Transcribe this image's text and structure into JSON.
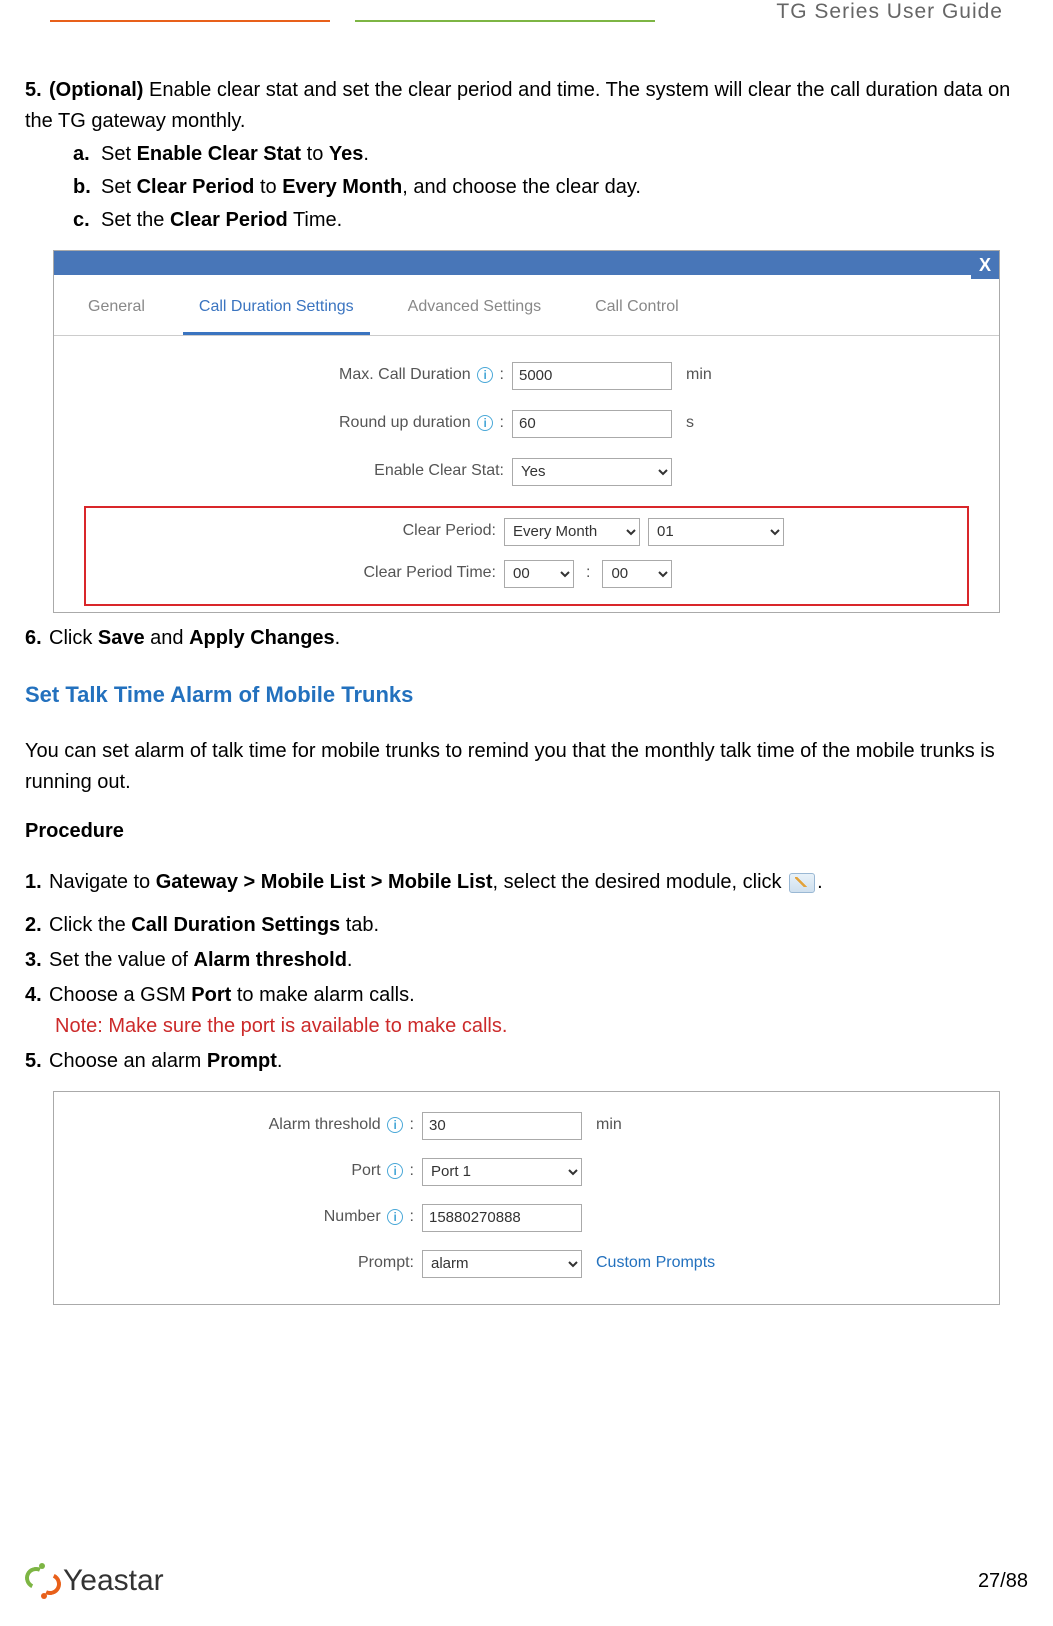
{
  "header": {
    "product": "TG  Series  User  Guide"
  },
  "section1": {
    "step5": {
      "num": "5.",
      "body_1": "(Optional)",
      "body_2": " Enable clear stat and set the clear period and time. The system will clear the call duration data on the TG gateway monthly.",
      "a": {
        "num": "a.",
        "pre": "Set ",
        "b1": "Enable Clear Stat",
        "mid": " to ",
        "b2": "Yes",
        "post": "."
      },
      "b": {
        "num": "b.",
        "pre": "Set ",
        "b1": "Clear Period",
        "mid": " to ",
        "b2": "Every Month",
        "post": ", and choose the clear day."
      },
      "c": {
        "num": "c.",
        "pre": "Set the ",
        "b1": "Clear Period",
        "post": " Time."
      }
    },
    "step6": {
      "num": "6.",
      "pre": "Click ",
      "b1": "Save",
      "mid": " and ",
      "b2": "Apply Changes",
      "post": "."
    }
  },
  "dialog1": {
    "close": "X",
    "tabs": {
      "general": "General",
      "callduration": "Call Duration Settings",
      "advanced": "Advanced Settings",
      "callcontrol": "Call Control"
    },
    "labels": {
      "maxcall": "Max. Call Duration",
      "roundup": "Round up duration",
      "enableclear": "Enable Clear Stat:",
      "clearperiod": "Clear Period:",
      "clearperiodtime": "Clear Period Time:"
    },
    "values": {
      "maxcall": "5000",
      "roundup": "60",
      "enableclear": "Yes",
      "clearperiod": "Every Month",
      "clearday": "01",
      "hour": "00",
      "minute": "00"
    },
    "units": {
      "min": "min",
      "s": "s"
    }
  },
  "section2": {
    "heading": "Set Talk Time Alarm of Mobile Trunks",
    "intro": "You can set alarm of talk time for mobile trunks to remind you that the monthly talk time of the mobile trunks is running out.",
    "procedure": "Procedure",
    "step1": {
      "num": "1.",
      "pre": "Navigate to ",
      "b1": "Gateway > Mobile List > Mobile List",
      "mid": ", select the desired module, click ",
      "post": "."
    },
    "step2": {
      "num": "2.",
      "pre": "Click the ",
      "b1": "Call Duration Settings",
      "post": " tab."
    },
    "step3": {
      "num": "3.",
      "pre": "Set the value of ",
      "b1": "Alarm threshold",
      "post": "."
    },
    "step4": {
      "num": "4.",
      "pre": "Choose a GSM ",
      "b1": "Port",
      "post": " to make alarm calls."
    },
    "note": "Note: Make sure the port is available to make calls.",
    "step5": {
      "num": "5.",
      "pre": "Choose an alarm ",
      "b1": "Prompt",
      "post": "."
    }
  },
  "dialog2": {
    "labels": {
      "alarm": "Alarm threshold",
      "port": "Port",
      "number": "Number",
      "prompt": "Prompt:"
    },
    "values": {
      "alarm": "30",
      "port": "Port 1",
      "number": "15880270888",
      "prompt": "alarm"
    },
    "units": {
      "min": "min"
    },
    "link": "Custom Prompts"
  },
  "footer": {
    "brand": "Yeastar",
    "page": "27/88"
  }
}
